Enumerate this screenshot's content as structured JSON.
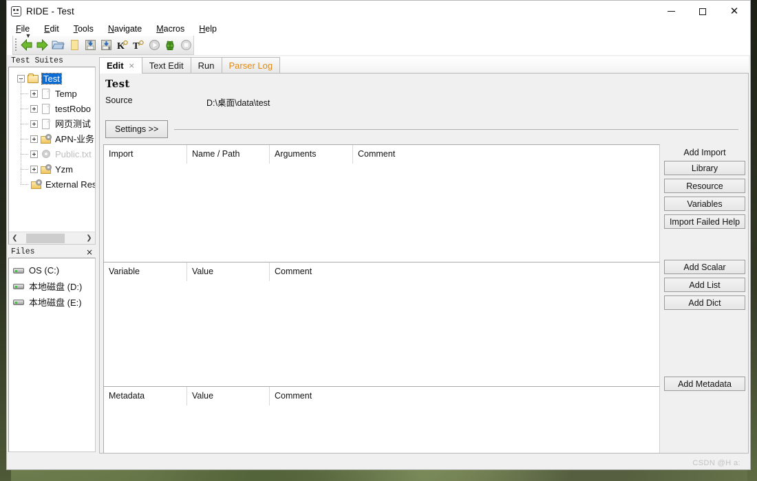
{
  "window": {
    "title": "RIDE - Test",
    "app_icon": "robot-icon",
    "minimize": "minimize-icon",
    "maximize": "maximize-icon",
    "close": "close-icon"
  },
  "menubar": {
    "items": [
      {
        "label": "File",
        "mnemonic": "F"
      },
      {
        "label": "Edit",
        "mnemonic": "E"
      },
      {
        "label": "Tools",
        "mnemonic": "T"
      },
      {
        "label": "Navigate",
        "mnemonic": "N"
      },
      {
        "label": "Macros",
        "mnemonic": "M"
      },
      {
        "label": "Help",
        "mnemonic": "H"
      }
    ]
  },
  "toolbar": {
    "buttons": [
      {
        "name": "back-icon",
        "glyph": "◀"
      },
      {
        "name": "forward-icon",
        "glyph": "▶"
      },
      {
        "name": "open-folder-icon",
        "glyph": "📂"
      },
      {
        "name": "new-file-icon",
        "glyph": "▯"
      },
      {
        "name": "save-icon",
        "glyph": "💾"
      },
      {
        "name": "save-all-icon",
        "glyph": "💾"
      },
      {
        "name": "search-keyword-icon",
        "glyph": "K"
      },
      {
        "name": "search-test-icon",
        "glyph": "T"
      },
      {
        "name": "run-icon",
        "glyph": "▶"
      },
      {
        "name": "debug-icon",
        "glyph": "🐞"
      },
      {
        "name": "stop-icon",
        "glyph": "■"
      }
    ]
  },
  "sidebar": {
    "test_suites": {
      "caption": "Test Suites",
      "tree": [
        {
          "label": "Test",
          "level": 0,
          "icon": "folder-open",
          "expander": "minus",
          "selected": true,
          "dim": false
        },
        {
          "label": "Temp",
          "level": 1,
          "icon": "file",
          "expander": "plus",
          "selected": false,
          "dim": false
        },
        {
          "label": "testRobo",
          "level": 1,
          "icon": "file",
          "expander": "plus",
          "selected": false,
          "dim": false
        },
        {
          "label": "网页测试",
          "level": 1,
          "icon": "file",
          "expander": "plus",
          "selected": false,
          "dim": false
        },
        {
          "label": "APN-业务",
          "level": 1,
          "icon": "folder-gear",
          "expander": "plus",
          "selected": false,
          "dim": false
        },
        {
          "label": "Public.txt",
          "level": 1,
          "icon": "gear-dim",
          "expander": "plus",
          "selected": false,
          "dim": true
        },
        {
          "label": "Yzm",
          "level": 1,
          "icon": "folder-gear",
          "expander": "plus",
          "selected": false,
          "dim": false
        },
        {
          "label": "External Res",
          "level": 1,
          "icon": "folder-gear",
          "expander": "none",
          "selected": false,
          "dim": false
        }
      ],
      "scroll_left": "◀",
      "scroll_right": "▶"
    },
    "files": {
      "caption": "Files",
      "close": "×",
      "drives": [
        {
          "label": "OS (C:)"
        },
        {
          "label": "本地磁盘 (D:)"
        },
        {
          "label": "本地磁盘 (E:)"
        }
      ]
    }
  },
  "main": {
    "tabs": [
      {
        "label": "Edit",
        "active": true,
        "closable": true,
        "close": "×",
        "style": "normal"
      },
      {
        "label": "Text Edit",
        "active": false,
        "closable": false,
        "close": "",
        "style": "normal"
      },
      {
        "label": "Run",
        "active": false,
        "closable": false,
        "close": "",
        "style": "normal"
      },
      {
        "label": "Parser Log",
        "active": false,
        "closable": false,
        "close": "",
        "style": "orange"
      }
    ],
    "editor": {
      "title": "Test",
      "source_label": "Source",
      "source_value": "D:\\桌面\\data\\test",
      "settings_button": "Settings >>"
    },
    "grids": [
      {
        "id": "imports",
        "headers": [
          "Import",
          "Name / Path",
          "Arguments",
          "Comment"
        ],
        "rows": []
      },
      {
        "id": "variables",
        "headers": [
          "Variable",
          "Value",
          "Comment"
        ],
        "rows": []
      },
      {
        "id": "metadata",
        "headers": [
          "Metadata",
          "Value",
          "Comment"
        ],
        "rows": []
      }
    ],
    "side_panel": {
      "add_import_title": "Add Import",
      "import_buttons": [
        {
          "label": "Library"
        },
        {
          "label": "Resource"
        },
        {
          "label": "Variables"
        },
        {
          "label": "Import Failed Help"
        }
      ],
      "variable_buttons": [
        {
          "label": "Add Scalar"
        },
        {
          "label": "Add List"
        },
        {
          "label": "Add Dict"
        }
      ],
      "metadata_buttons": [
        {
          "label": "Add Metadata"
        }
      ]
    }
  },
  "watermark": "CSDN @H a:",
  "colors": {
    "selection": "#0a6cd4",
    "accent_orange": "#e08a14",
    "window_bg": "#f0f0f0",
    "grid_bg": "#ffffff"
  }
}
